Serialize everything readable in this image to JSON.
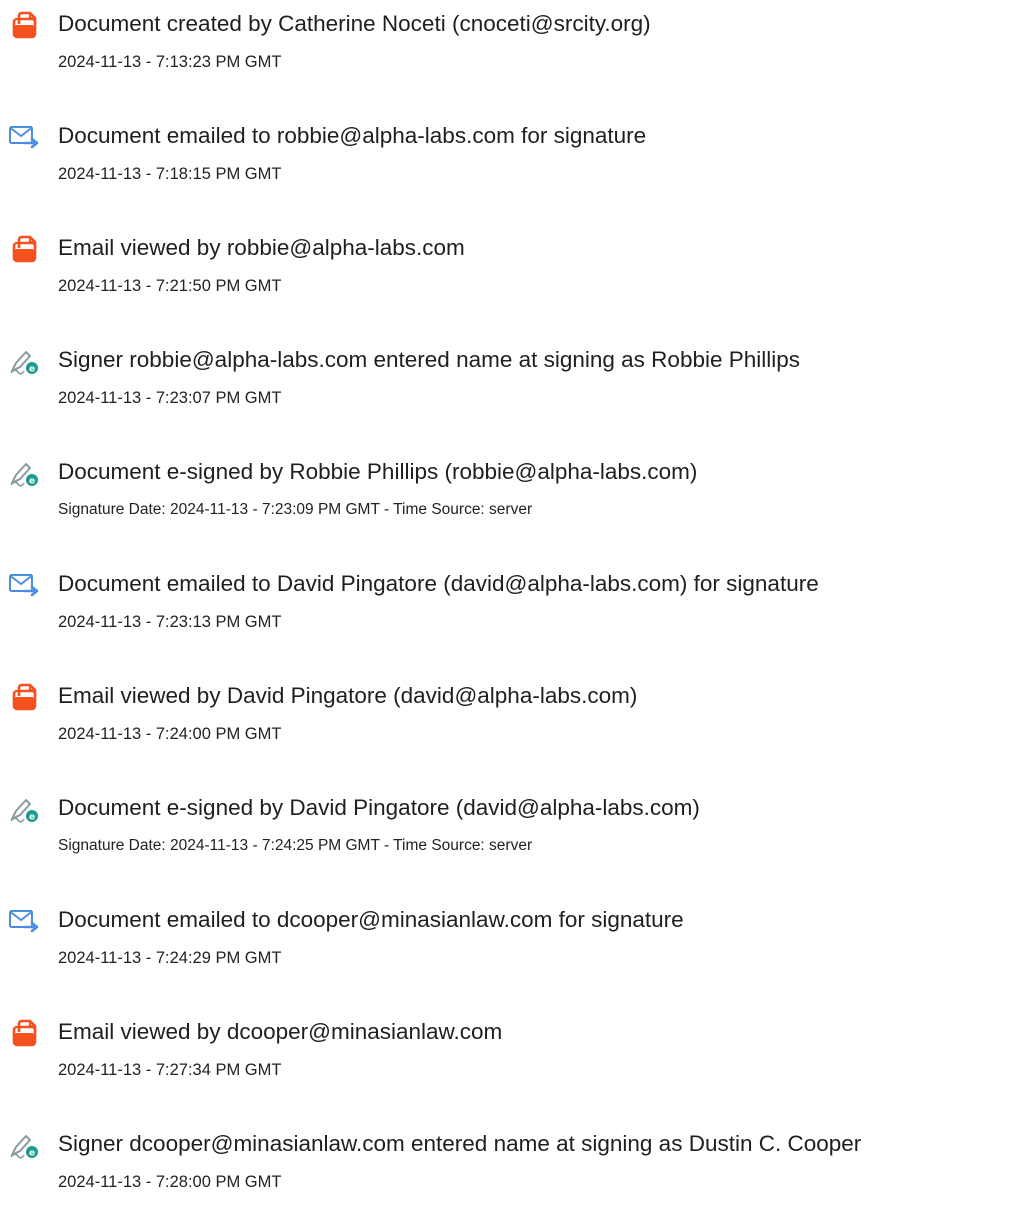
{
  "events": [
    {
      "icon": "document-created-icon",
      "title": "Document created by Catherine Noceti (cnoceti@srcity.org)",
      "time": "2024-11-13 - 7:13:23 PM GMT"
    },
    {
      "icon": "email-sent-icon",
      "title": "Document emailed to robbie@alpha-labs.com for signature",
      "time": "2024-11-13 - 7:18:15 PM GMT"
    },
    {
      "icon": "document-viewed-icon",
      "title": "Email viewed by robbie@alpha-labs.com",
      "time": "2024-11-13 - 7:21:50 PM GMT"
    },
    {
      "icon": "e-sign-pen-icon",
      "title": "Signer robbie@alpha-labs.com entered name at signing as Robbie Phillips",
      "time": "2024-11-13 - 7:23:07 PM GMT"
    },
    {
      "icon": "e-sign-pen-icon",
      "title": "Document e-signed by Robbie Phillips (robbie@alpha-labs.com)",
      "time": "Signature Date: 2024-11-13 - 7:23:09 PM GMT - Time Source: server"
    },
    {
      "icon": "email-sent-icon",
      "title": "Document emailed to David Pingatore (david@alpha-labs.com) for signature",
      "time": "2024-11-13 - 7:23:13 PM GMT"
    },
    {
      "icon": "document-viewed-icon",
      "title": "Email viewed by David Pingatore (david@alpha-labs.com)",
      "time": "2024-11-13 - 7:24:00 PM GMT"
    },
    {
      "icon": "e-sign-pen-icon",
      "title": "Document e-signed by David Pingatore (david@alpha-labs.com)",
      "time": "Signature Date: 2024-11-13 - 7:24:25 PM GMT - Time Source: server"
    },
    {
      "icon": "email-sent-icon",
      "title": "Document emailed to dcooper@minasianlaw.com for signature",
      "time": "2024-11-13 - 7:24:29 PM GMT"
    },
    {
      "icon": "document-viewed-icon",
      "title": "Email viewed by dcooper@minasianlaw.com",
      "time": "2024-11-13 - 7:27:34 PM GMT"
    },
    {
      "icon": "e-sign-pen-icon",
      "title": "Signer dcooper@minasianlaw.com entered name at signing as Dustin C. Cooper",
      "time": "2024-11-13 - 7:28:00 PM GMT"
    }
  ],
  "colors": {
    "document_icon": "#f4511e",
    "email_icon": "#4a90e2",
    "pen_icon": "#1a9e8f"
  }
}
